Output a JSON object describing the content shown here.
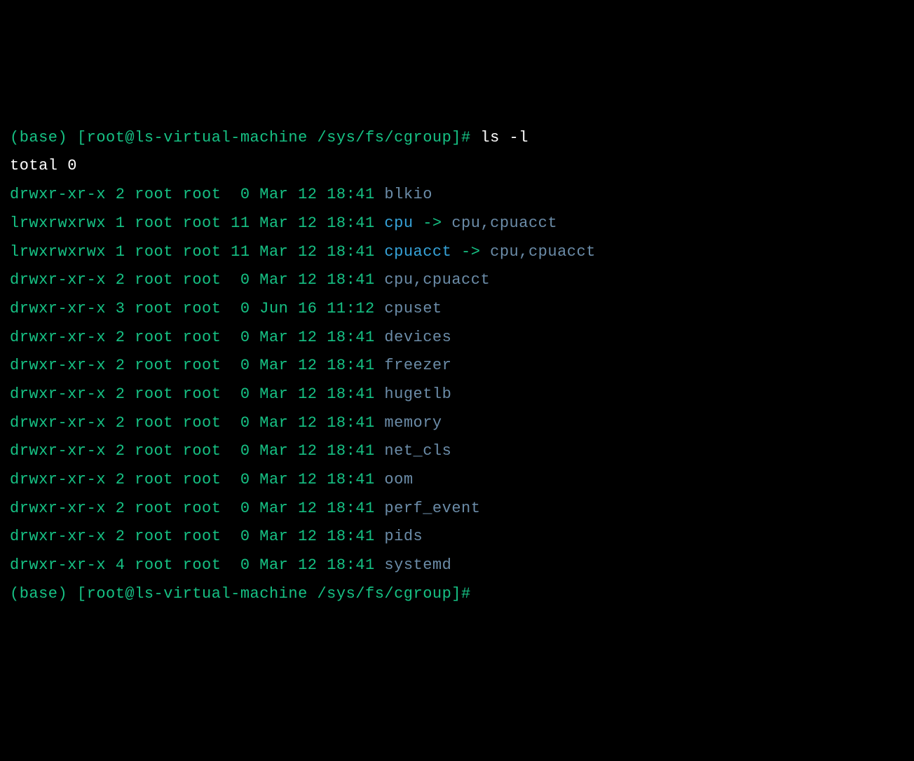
{
  "prompt1": {
    "env": "(base)",
    "userhost": "[root@ls-virtual-machine /sys/fs/cgroup]#",
    "cmd": "ls -l"
  },
  "total_line": "total 0",
  "rows": [
    {
      "perms": "drwxr-xr-x",
      "links": "2",
      "owner": "root",
      "group": "root",
      "size": " 0",
      "date": "Mar 12 18:41",
      "name": "blkio",
      "type": "dir"
    },
    {
      "perms": "lrwxrwxrwx",
      "links": "1",
      "owner": "root",
      "group": "root",
      "size": "11",
      "date": "Mar 12 18:41",
      "name": "cpu",
      "type": "link",
      "arrow": " -> ",
      "target": "cpu,cpuacct"
    },
    {
      "perms": "lrwxrwxrwx",
      "links": "1",
      "owner": "root",
      "group": "root",
      "size": "11",
      "date": "Mar 12 18:41",
      "name": "cpuacct",
      "type": "link",
      "arrow": " -> ",
      "target": "cpu,cpuacct"
    },
    {
      "perms": "drwxr-xr-x",
      "links": "2",
      "owner": "root",
      "group": "root",
      "size": " 0",
      "date": "Mar 12 18:41",
      "name": "cpu,cpuacct",
      "type": "dir"
    },
    {
      "perms": "drwxr-xr-x",
      "links": "3",
      "owner": "root",
      "group": "root",
      "size": " 0",
      "date": "Jun 16 11:12",
      "name": "cpuset",
      "type": "dir"
    },
    {
      "perms": "drwxr-xr-x",
      "links": "2",
      "owner": "root",
      "group": "root",
      "size": " 0",
      "date": "Mar 12 18:41",
      "name": "devices",
      "type": "dir"
    },
    {
      "perms": "drwxr-xr-x",
      "links": "2",
      "owner": "root",
      "group": "root",
      "size": " 0",
      "date": "Mar 12 18:41",
      "name": "freezer",
      "type": "dir"
    },
    {
      "perms": "drwxr-xr-x",
      "links": "2",
      "owner": "root",
      "group": "root",
      "size": " 0",
      "date": "Mar 12 18:41",
      "name": "hugetlb",
      "type": "dir"
    },
    {
      "perms": "drwxr-xr-x",
      "links": "2",
      "owner": "root",
      "group": "root",
      "size": " 0",
      "date": "Mar 12 18:41",
      "name": "memory",
      "type": "dir"
    },
    {
      "perms": "drwxr-xr-x",
      "links": "2",
      "owner": "root",
      "group": "root",
      "size": " 0",
      "date": "Mar 12 18:41",
      "name": "net_cls",
      "type": "dir"
    },
    {
      "perms": "drwxr-xr-x",
      "links": "2",
      "owner": "root",
      "group": "root",
      "size": " 0",
      "date": "Mar 12 18:41",
      "name": "oom",
      "type": "dir"
    },
    {
      "perms": "drwxr-xr-x",
      "links": "2",
      "owner": "root",
      "group": "root",
      "size": " 0",
      "date": "Mar 12 18:41",
      "name": "perf_event",
      "type": "dir"
    },
    {
      "perms": "drwxr-xr-x",
      "links": "2",
      "owner": "root",
      "group": "root",
      "size": " 0",
      "date": "Mar 12 18:41",
      "name": "pids",
      "type": "dir"
    },
    {
      "perms": "drwxr-xr-x",
      "links": "4",
      "owner": "root",
      "group": "root",
      "size": " 0",
      "date": "Mar 12 18:41",
      "name": "systemd",
      "type": "dir"
    }
  ],
  "prompt2": {
    "env": "(base)",
    "userhost": "[root@ls-virtual-machine /sys/fs/cgroup]#"
  }
}
